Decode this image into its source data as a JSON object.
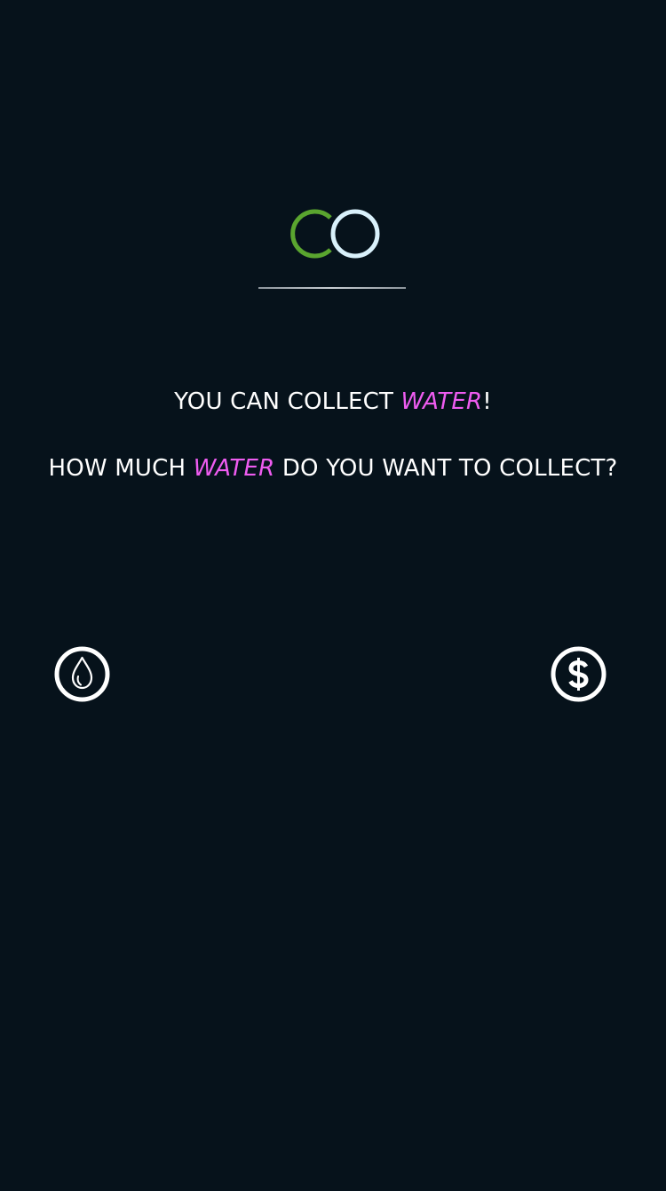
{
  "colors": {
    "background": "#06121b",
    "text": "#ffffff",
    "accent": "#ee5cf0",
    "logo_left_ring": "#5aa52f",
    "logo_right_ring": "#d9f1fb"
  },
  "logo": {
    "icon": "co-rings-logo"
  },
  "intro": {
    "line1_prefix": "YOU CAN COLLECT ",
    "line1_accent": "WATER",
    "line1_suffix": "!",
    "line2_prefix": "HOW MUCH ",
    "line2_accent": "WATER",
    "line2_suffix": " DO YOU WANT TO COLLECT?"
  },
  "options": [
    {
      "icon": "water-drop-icon"
    },
    {
      "icon": "dollar-icon"
    }
  ]
}
